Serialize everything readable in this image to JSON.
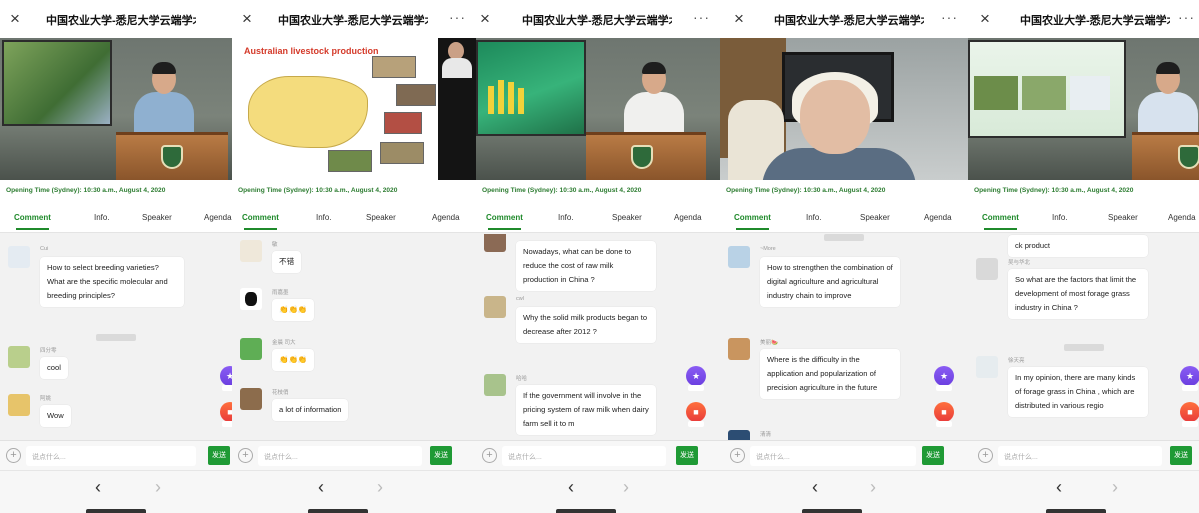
{
  "close_glyph": "×",
  "more_glyph": "···",
  "back_glyph": "‹",
  "forward_glyph": "›",
  "window_title": "中国农业大学-悉尼大学云端学术",
  "opening_time": "Opening Time (Sydney): 10:30 a.m., August 4, 2020",
  "tabs": [
    "Comment",
    "Info.",
    "Speaker",
    "Agenda"
  ],
  "input_placeholder": "说点什么...",
  "send_label": "发送",
  "slide_title": "Australian livestock production",
  "panels": [
    {
      "messages": [
        {
          "user": "Cui",
          "text": "How to select breeding varieties? What are the specific molecular and breeding principles?"
        },
        {
          "user": "四分零",
          "text": "cool"
        },
        {
          "user": "阿姚",
          "text": "Wow"
        }
      ]
    },
    {
      "messages": [
        {
          "user": "敏",
          "text": "不错"
        },
        {
          "user": "雨嘉墨",
          "text": "👏👏👏"
        },
        {
          "user": "金晨 司大",
          "text": "👏👏👏"
        },
        {
          "user": "花枝俏",
          "text": "a lot of information"
        }
      ]
    },
    {
      "messages": [
        {
          "user": "",
          "text": "Nowadays, what can be done to reduce the cost of raw milk production in China ?"
        },
        {
          "user": "cwl",
          "text": "Why the solid milk products began to decrease after 2012 ?"
        },
        {
          "user": "哈哈",
          "text": "If the government will involve in the pricing system of raw milk when dairy farm sell it to m"
        }
      ]
    },
    {
      "messages": [
        {
          "user": "~More",
          "text": "How to strengthen the combination of digital agriculture and agricultural industry chain to improve"
        },
        {
          "user": "美丽🍉",
          "text": "Where is the difficulty in the application and popularization of precision agriculture in the future"
        },
        {
          "user": "清清",
          "text": ""
        }
      ]
    },
    {
      "messages": [
        {
          "user": "",
          "text": "ck product"
        },
        {
          "user": "吴与华北",
          "text": "So what are the factors that limit the development of most forage grass industry in China ?"
        },
        {
          "user": "徐天亮",
          "text": "In my opinion, there are many kinds of forage grass in China , which are distributed in various regio"
        }
      ]
    }
  ]
}
